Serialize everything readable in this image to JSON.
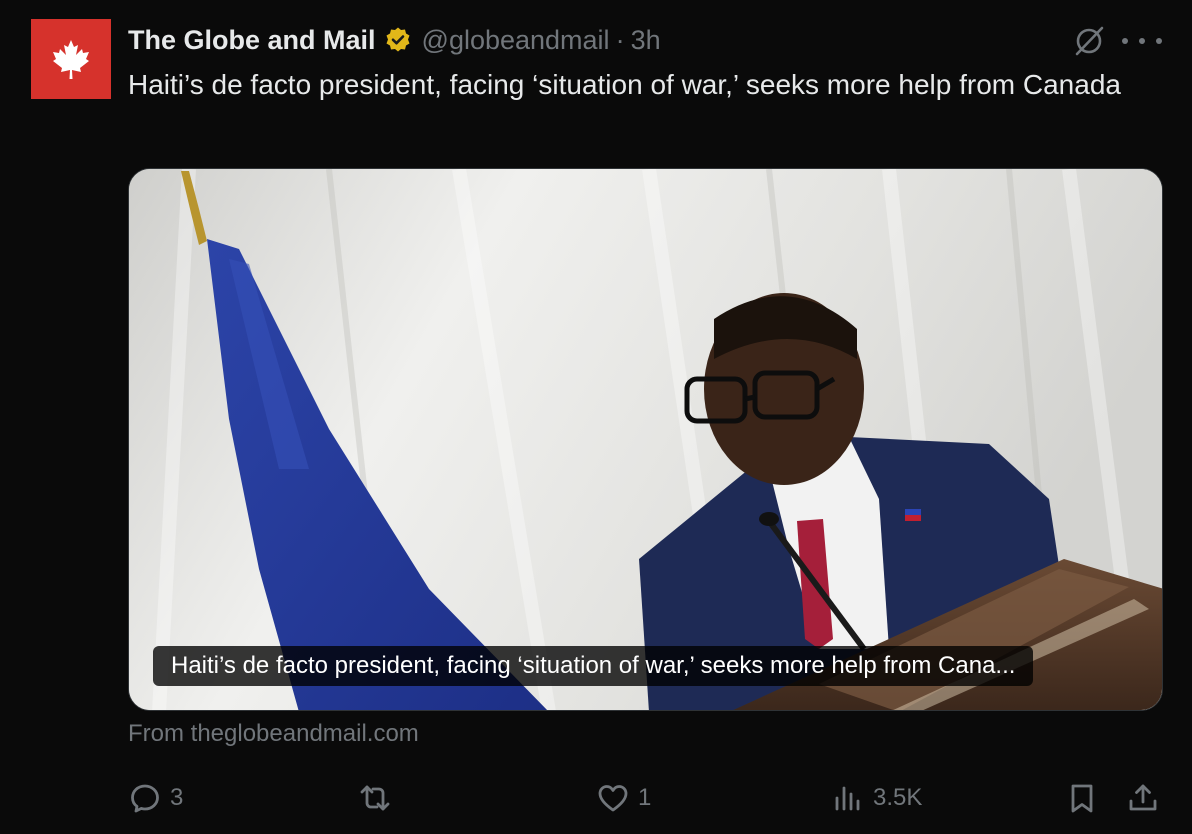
{
  "account": {
    "name": "The Globe and Mail",
    "handle": "@globeandmail",
    "separator": "·",
    "time": "3h",
    "verified_color": "#e2b719",
    "avatar_color": "#d6322c"
  },
  "tweet": {
    "text": "Haiti’s de facto president, facing ‘situation of war,’ seeks more help from Canada"
  },
  "card": {
    "caption": "Haiti’s de facto president, facing ‘situation of war,’ seeks more help from Cana...",
    "source": "From theglobeandmail.com"
  },
  "actions": {
    "replies": "3",
    "reposts": "",
    "likes": "1",
    "views": "3.5K"
  },
  "icons": [
    "maple-leaf-icon",
    "verified-badge-icon",
    "grok-icon",
    "more-icon",
    "reply-icon",
    "repost-icon",
    "like-icon",
    "views-icon",
    "bookmark-icon",
    "share-icon"
  ]
}
